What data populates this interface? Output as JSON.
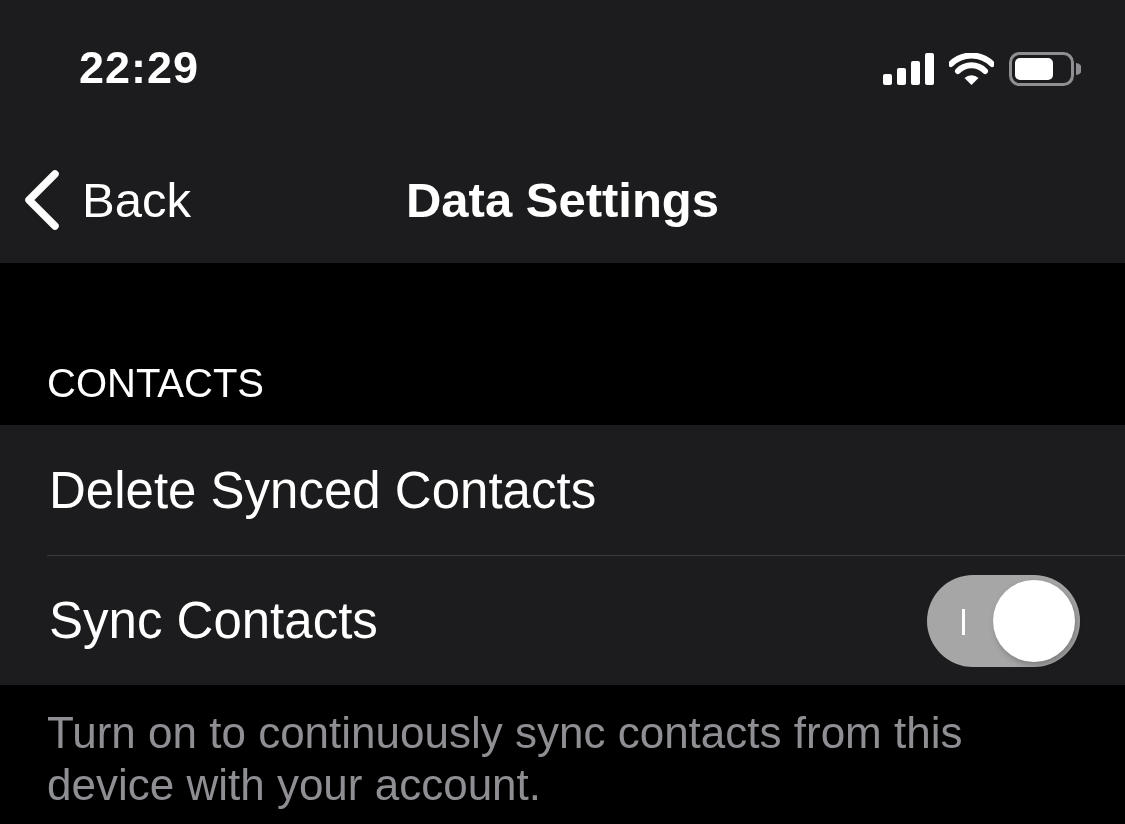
{
  "status_bar": {
    "time": "22:29"
  },
  "nav_bar": {
    "back_label": "Back",
    "title": "Data Settings"
  },
  "sections": [
    {
      "header": "CONTACTS",
      "rows": [
        {
          "kind": "action",
          "label": "Delete Synced Contacts"
        },
        {
          "kind": "toggle",
          "label": "Sync Contacts",
          "on": true
        }
      ],
      "footer": "Turn on to continuously sync contacts from this device with your account."
    }
  ]
}
